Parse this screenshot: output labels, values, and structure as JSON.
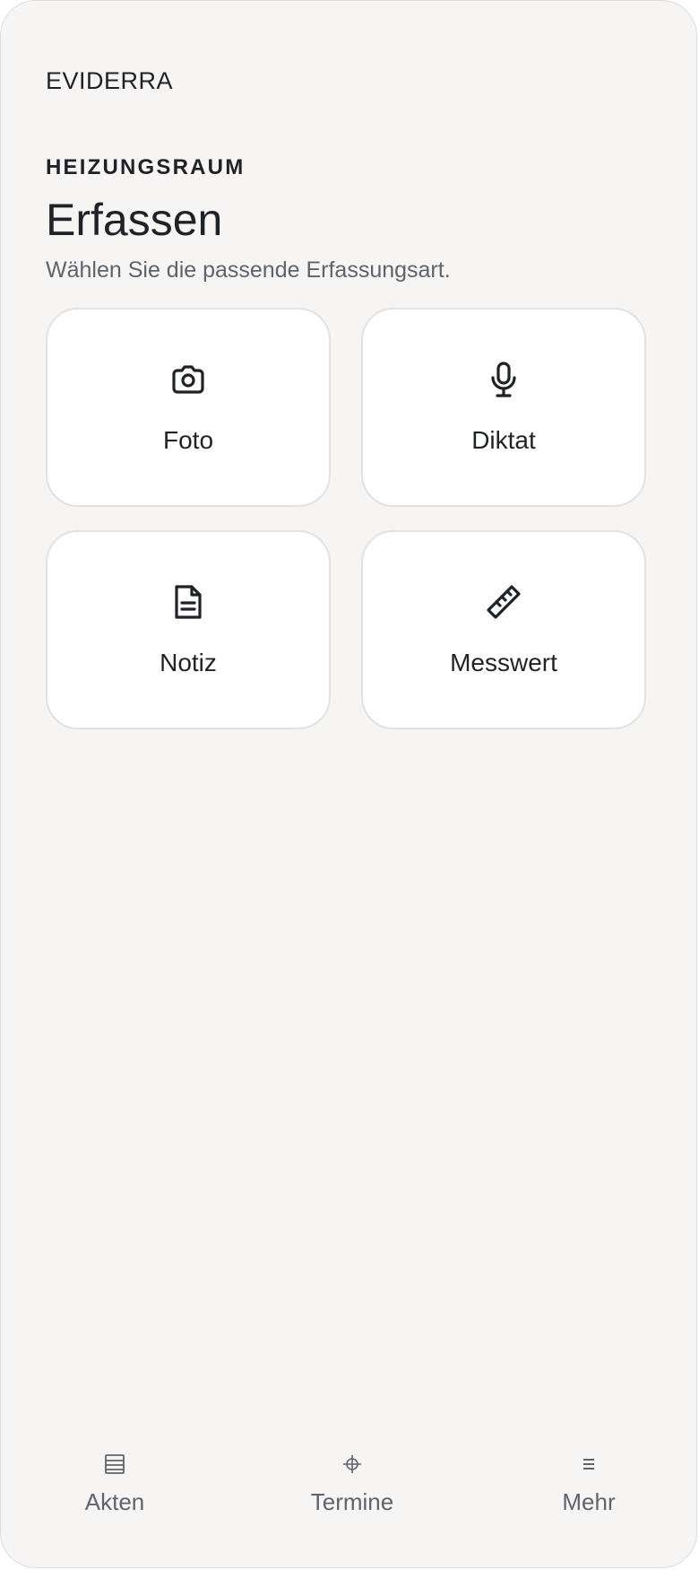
{
  "app": {
    "brand": "EVIDERRA"
  },
  "header": {
    "section_label": "HEIZUNGSRAUM",
    "title": "Erfassen",
    "subtitle": "Wählen Sie die passende Erfassungsart."
  },
  "capture_options": [
    {
      "label": "Foto",
      "icon": "camera-icon"
    },
    {
      "label": "Diktat",
      "icon": "microphone-icon"
    },
    {
      "label": "Notiz",
      "icon": "document-icon"
    },
    {
      "label": "Messwert",
      "icon": "ruler-icon"
    }
  ],
  "bottom_nav": {
    "items": [
      {
        "label": "Akten",
        "icon": "files-icon"
      },
      {
        "label": "Termine",
        "icon": "crosshair-icon"
      },
      {
        "label": "Mehr",
        "icon": "menu-icon"
      }
    ]
  },
  "colors": {
    "background": "#f6f5f4",
    "card": "#ffffff",
    "card_border": "#e3e2e0",
    "text_primary": "#1f2226",
    "text_secondary": "#5e646b"
  }
}
